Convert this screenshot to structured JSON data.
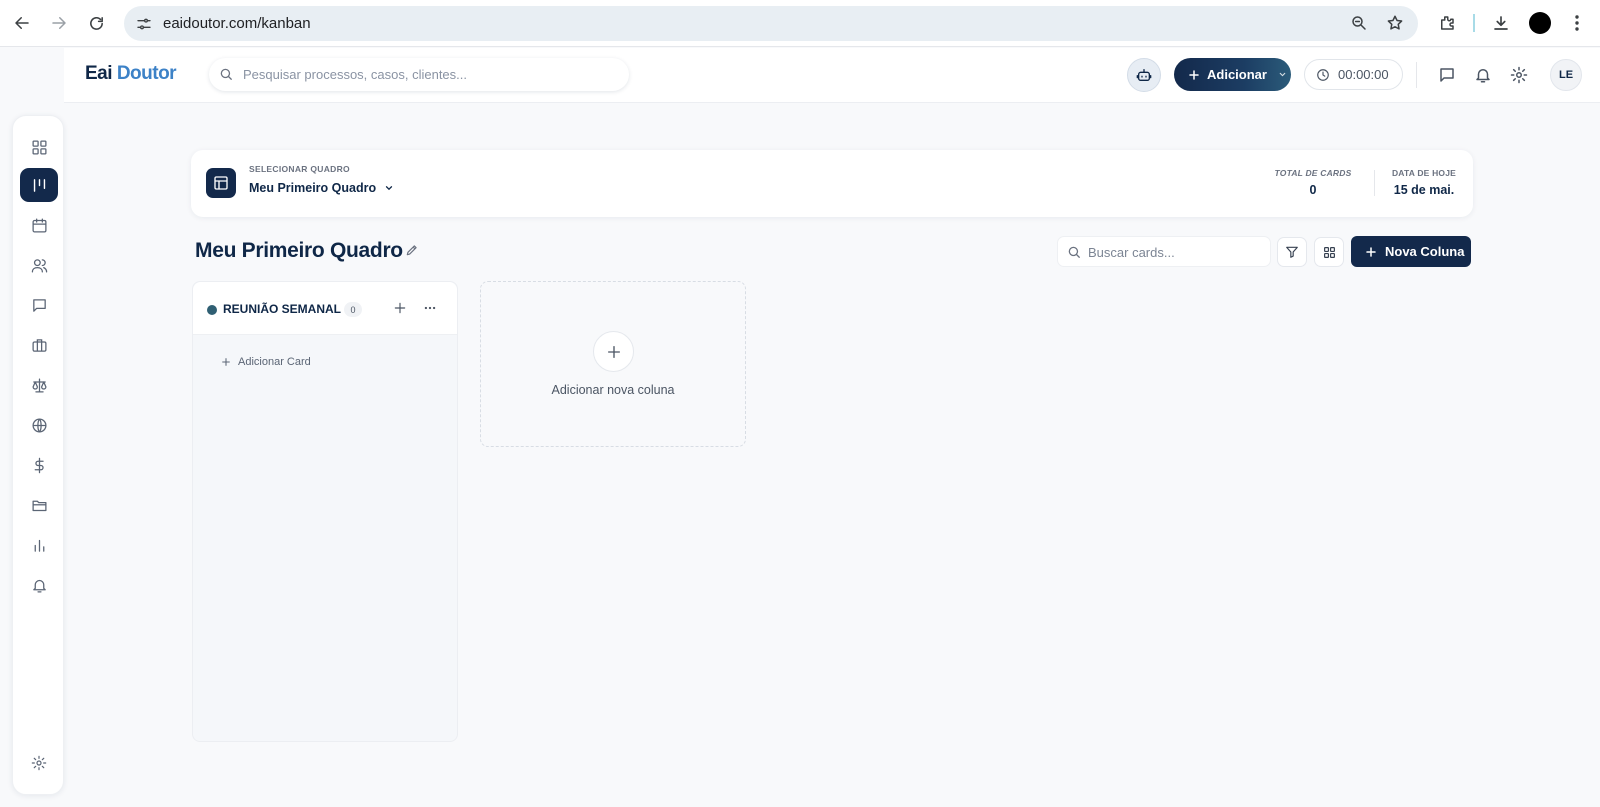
{
  "browser": {
    "url": "eaidoutor.com/kanban"
  },
  "header": {
    "logo_part1": "Eai",
    "logo_part2": "Doutor",
    "search_placeholder": "Pesquisar processos, casos, clientes...",
    "add_label": "Adicionar",
    "timer": "00:00:00",
    "avatar_initials": "LE"
  },
  "sidebar": {
    "items": [
      {
        "icon": "dashboard-icon"
      },
      {
        "icon": "kanban-icon",
        "active": true
      },
      {
        "icon": "calendar-icon"
      },
      {
        "icon": "users-icon"
      },
      {
        "icon": "message-icon"
      },
      {
        "icon": "briefcase-icon"
      },
      {
        "icon": "scale-icon"
      },
      {
        "icon": "globe-icon"
      },
      {
        "icon": "dollar-icon"
      },
      {
        "icon": "folder-icon"
      },
      {
        "icon": "chart-icon"
      },
      {
        "icon": "bell-icon"
      }
    ],
    "bottom_icon": "settings-icon"
  },
  "board_selector": {
    "label": "SELECIONAR QUADRO",
    "selected": "Meu Primeiro Quadro",
    "total_cards_label": "TOTAL DE CARDS",
    "total_cards_value": "0",
    "date_label": "DATA DE HOJE",
    "date_value": "15 de mai."
  },
  "board": {
    "title": "Meu Primeiro Quadro",
    "search_placeholder": "Buscar cards...",
    "new_column_label": "Nova Coluna",
    "columns": [
      {
        "title": "REUNIÃO SEMANAL",
        "count": "0",
        "dot_color": "#2f5f73",
        "add_card_label": "Adicionar Card"
      }
    ],
    "add_column_label": "Adicionar nova coluna"
  },
  "colors": {
    "primary": "#13294b",
    "accent": "#3d82c7"
  }
}
